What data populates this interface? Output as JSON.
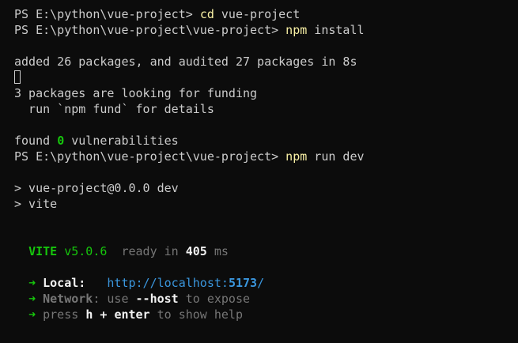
{
  "lines": {
    "l1": {
      "prompt": "PS E:\\python\\vue-project> ",
      "cmd": "cd",
      "args": " vue-project"
    },
    "l2": {
      "prompt": "PS E:\\python\\vue-project\\vue-project> ",
      "cmd": "npm",
      "args": " install"
    },
    "l4": {
      "text": "added 26 packages, and audited 27 packages in 8s"
    },
    "l6": {
      "text": "3 packages are looking for funding"
    },
    "l7": {
      "text": "  run `npm fund` for details"
    },
    "l9": {
      "pre": "found ",
      "count": "0",
      "post": " vulnerabilities"
    },
    "l10": {
      "prompt": "PS E:\\python\\vue-project\\vue-project> ",
      "cmd": "npm",
      "args": " run dev"
    },
    "l12": {
      "text": "> vue-project@0.0.0 dev"
    },
    "l13": {
      "text": "> vite"
    },
    "l16": {
      "name": "VITE",
      "version": " v5.0.6",
      "ready": "  ready in ",
      "ms_value": "405",
      "ms_unit": " ms"
    },
    "l18": {
      "arrow": "➜",
      "label": "Local:",
      "gap": "   ",
      "url_base": "http://localhost:",
      "port": "5173",
      "slash": "/"
    },
    "l19": {
      "arrow": "➜",
      "label": "Network",
      "colon": ": use ",
      "flag": "--host",
      "tail": " to expose"
    },
    "l20": {
      "arrow": "➜",
      "pre": " press ",
      "key1": "h",
      "plus": " + ",
      "key2": "enter",
      "tail": " to show help"
    }
  },
  "colors": {
    "background": "#0c0c0c",
    "foreground": "#cccccc",
    "command": "#f9f1a5",
    "green": "#16c60c",
    "cyan": "#3a96dd",
    "dim": "#767676"
  }
}
